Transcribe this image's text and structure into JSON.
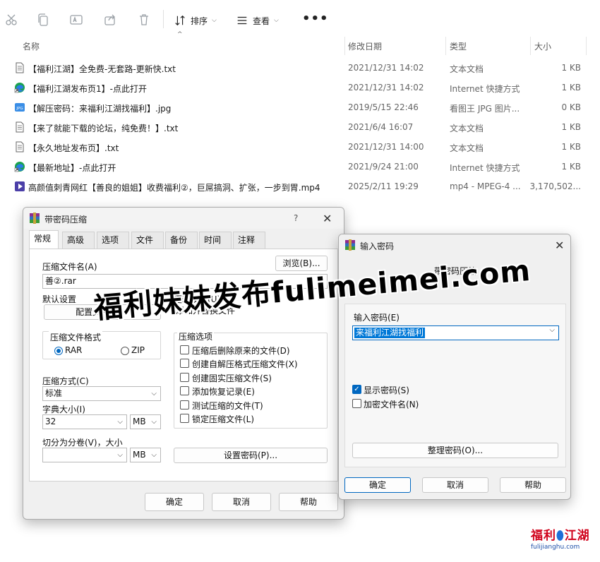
{
  "toolbar": {
    "sort_label": "排序",
    "view_label": "查看",
    "more_label": "•••"
  },
  "columns": {
    "name": "名称",
    "modified": "修改日期",
    "type": "类型",
    "size": "大小"
  },
  "files": [
    {
      "name": "【福利江湖】全免费-无套路-更新快.txt",
      "date": "2021/12/31 14:02",
      "type": "文本文档",
      "size": "1 KB",
      "icon": "text-file-icon"
    },
    {
      "name": "【福利江湖发布页1】-点此打开",
      "date": "2021/12/31 14:02",
      "type": "Internet 快捷方式",
      "size": "1 KB",
      "icon": "edge-shortcut-icon"
    },
    {
      "name": "【解压密码：来福利江湖找福利】.jpg",
      "date": "2019/5/15 22:46",
      "type": "看图王 JPG 图片...",
      "size": "0 KB",
      "icon": "jpg-file-icon"
    },
    {
      "name": "【来了就能下载的论坛，纯免费！】.txt",
      "date": "2021/6/4 16:07",
      "type": "文本文档",
      "size": "1 KB",
      "icon": "text-file-icon"
    },
    {
      "name": "【永久地址发布页】.txt",
      "date": "2021/12/31 14:00",
      "type": "文本文档",
      "size": "1 KB",
      "icon": "text-file-icon"
    },
    {
      "name": "【最新地址】-点此打开",
      "date": "2021/9/24 21:00",
      "type": "Internet 快捷方式",
      "size": "1 KB",
      "icon": "edge-shortcut-icon"
    },
    {
      "name": "高颜值刺青网红【善良的姐姐】收费福利②，巨屌搞洞、扩张，一步到胃.mp4",
      "date": "2025/2/11 19:29",
      "type": "mp4 - MPEG-4 ...",
      "size": "3,170,502...",
      "icon": "video-file-icon"
    }
  ],
  "archive_dialog": {
    "title": "带密码压缩",
    "help_glyph": "?",
    "tabs": [
      "常规",
      "高级",
      "选项",
      "文件",
      "备份",
      "时间",
      "注释"
    ],
    "archive_name_label": "压缩文件名(A)",
    "browse_label": "浏览(B)...",
    "archive_name_value": "善②.rar",
    "default_settings_label": "默认设置",
    "profiles_label": "配置文件(F)...",
    "update_mode_label": "更新模式(U)",
    "update_mode_value": "添加并替换文件",
    "format_label": "压缩文件格式",
    "format_rar": "RAR",
    "format_zip": "ZIP",
    "options_label": "压缩选项",
    "options": [
      "压缩后删除原来的文件(D)",
      "创建自解压格式压缩文件(X)",
      "创建固实压缩文件(S)",
      "添加恢复记录(E)",
      "测试压缩的文件(T)",
      "锁定压缩文件(L)"
    ],
    "method_label": "压缩方式(C)",
    "method_value": "标准",
    "dict_label": "字典大小(I)",
    "dict_value": "32",
    "dict_unit": "MB",
    "split_label": "切分为分卷(V)，大小",
    "split_value": "",
    "split_unit": "MB",
    "set_password_label": "设置密码(P)...",
    "ok_label": "确定",
    "cancel_label": "取消",
    "help_label": "帮助"
  },
  "password_dialog": {
    "title": "输入密码",
    "subtitle": "带密码压缩",
    "password_label": "输入密码(E)",
    "password_value": "来福利江湖找福利",
    "show_password_label": "显示密码(S)",
    "encrypt_names_label": "加密文件名(N)",
    "organize_label": "整理密码(O)...",
    "ok_label": "确定",
    "cancel_label": "取消",
    "help_label": "帮助"
  },
  "watermark": "福利妹妹发布fulimeimei.com",
  "logo": {
    "line1_a": "福利",
    "line1_b": "江湖",
    "line2": "fulijianghu.com"
  },
  "colors": {
    "accent": "#0067c0",
    "selection": "#0078d7",
    "logo_red": "#d0021b",
    "logo_blue": "#1d6fd8"
  }
}
